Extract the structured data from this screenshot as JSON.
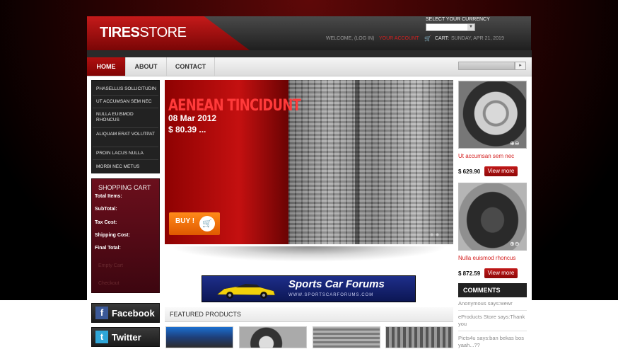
{
  "header": {
    "logo_bold": "TIRES",
    "logo_light": "STORE",
    "currency_label": "SELECT YOUR CURRENCY",
    "welcome": "WELCOME, (LOG IN)",
    "account": "YOUR ACCOUNT",
    "cart_label": "CART:",
    "date": "SUNDAY, APR 21, 2019"
  },
  "nav": {
    "items": [
      {
        "label": "HOME"
      },
      {
        "label": "ABOUT"
      },
      {
        "label": "CONTACT"
      }
    ]
  },
  "categories": [
    "PHASELLUS SOLLICITUDIN",
    "UT ACCUMSAN SEM NEC",
    "NULLA EUISMOD RHONCUS",
    "ALIQUAM ERAT VOLUTPAT",
    "PROIN LACUS NULLA",
    "MORBI NEC METUS"
  ],
  "cart": {
    "title": "SHOPPING CART",
    "rows": [
      "Total Items:",
      "SubTotal:",
      "Tax Cost:",
      "Shipping Cost:",
      "Final Total:"
    ],
    "empty": "Empty Cart",
    "checkout": "Checkout"
  },
  "social": {
    "facebook": "Facebook",
    "twitter": "Twitter"
  },
  "slider": {
    "title": "AENEAN TINCIDUNT",
    "date": "08 Mar 2012",
    "price": "$ 80.39 ...",
    "buy": "BUY !"
  },
  "banner": {
    "title": "Sports Car Forums",
    "url": "WWW.SPORTSCARFORUMS.COM"
  },
  "featured": {
    "title": "FEATURED PRODUCTS"
  },
  "products": [
    {
      "name": "Ut accumsan sem nec",
      "price": "$ 629.90",
      "button": "View more"
    },
    {
      "name": "Nulla euismod rhoncus",
      "price": "$ 872.59",
      "button": "View more"
    }
  ],
  "comments": {
    "title": "COMMENTS",
    "items": [
      "Anonymous says:wewr",
      "eProducts Store says:Thank you",
      "Picts4u says:ban bekas bos yaah...??"
    ]
  },
  "colors": {
    "brand_red": "#b01010",
    "link_red": "#d42020",
    "buy_orange": "#ff8a1a"
  }
}
